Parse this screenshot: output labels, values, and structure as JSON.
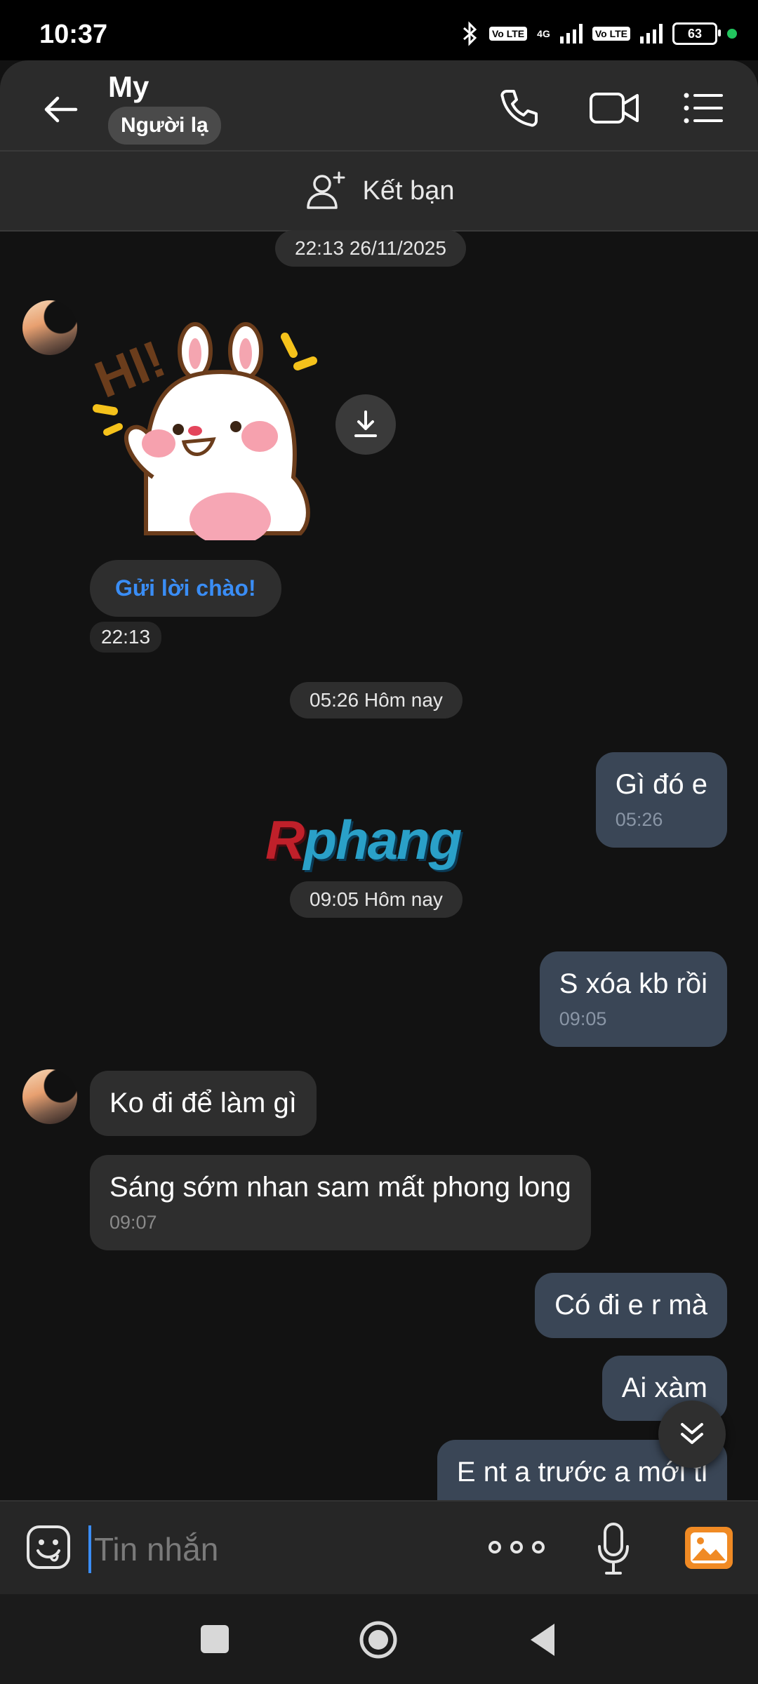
{
  "status_bar": {
    "time": "10:37",
    "volte_1": "Vo LTE",
    "network": "4G",
    "volte_2": "Vo LTE",
    "battery": "63"
  },
  "header": {
    "contact_name": "My",
    "badge": "Người lạ",
    "icons": [
      "back-arrow-icon",
      "phone-icon",
      "video-camera-icon",
      "menu-list-icon"
    ]
  },
  "add_friend": {
    "label": "Kết bạn"
  },
  "chat": {
    "timestamps": {
      "first": "22:13 26/11/2025",
      "second": "05:26 Hôm nay",
      "third": "09:05 Hôm nay"
    },
    "sticker": {
      "greet_button": "Gửi lời chào!",
      "time": "22:13",
      "sticker_text": "HI!"
    },
    "messages": [
      {
        "direction": "out",
        "text": "Gì đó e",
        "time": "05:26"
      },
      {
        "direction": "out",
        "text": "S xóa kb rồi",
        "time": "09:05"
      },
      {
        "direction": "in",
        "text": "Ko đi để làm gì",
        "time": ""
      },
      {
        "direction": "in",
        "text": "Sáng sớm nhan sam mất phong long",
        "time": "09:07"
      },
      {
        "direction": "out",
        "text": "Có đi e r mà",
        "time": ""
      },
      {
        "direction": "out",
        "text": "Ai xàm",
        "time": ""
      },
      {
        "direction": "out",
        "text": "E nt a trước a mới tl",
        "time": ""
      }
    ]
  },
  "watermark": {
    "first": "R",
    "rest": "phang"
  },
  "input_bar": {
    "placeholder": "Tin nhắn",
    "icons": [
      "emoji-icon",
      "more-dots-icon",
      "microphone-icon",
      "gallery-icon"
    ]
  },
  "colors": {
    "background": "#121212",
    "header": "#2b2b2b",
    "bubble_in": "#2e2e2e",
    "bubble_out": "#3a4656",
    "accent": "#3a8df5",
    "gallery": "#f08a24"
  }
}
